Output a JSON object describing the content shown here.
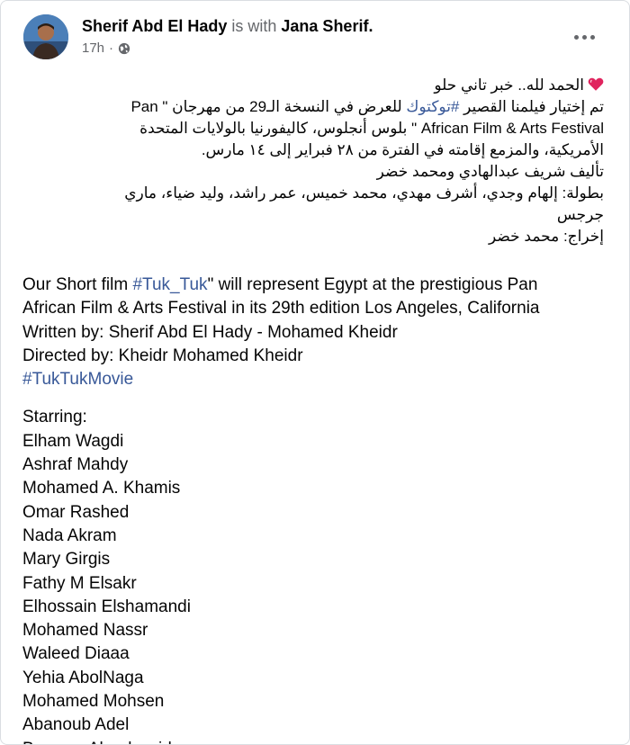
{
  "post": {
    "author": "Sherif Abd El Hady",
    "with_text": "is with",
    "tagged": "Jana Sherif.",
    "time": "17h",
    "separator": "·",
    "privacy_icon": "globe-icon",
    "more_icon": "more-options-icon"
  },
  "arabic": {
    "line1": "الحمد لله.. خبر تاني حلو",
    "line2_pre": "تم إختيار فيلمنا القصير ",
    "line2_tag": "#توكتوك",
    "line2_post": " للعرض في النسخة الـ29 من مهرجان \" Pan",
    "line3": "African Film & Arts Festival \" بلوس أنجلوس، كاليفورنيا بالولايات المتحدة",
    "line4": "الأمريكية، والمزمع إقامته في الفترة من ٢٨ فبراير إلى ١٤ مارس.",
    "line5": "تأليف شريف عبدالهادي ومحمد خضر",
    "line6": "بطولة: إلهام وجدي، أشرف مهدي، محمد خميس، عمر راشد، وليد ضياء، ماري",
    "line7": "جرجس",
    "line8": "إخراج: محمد خضر"
  },
  "english": {
    "line1_pre": "Our Short film ",
    "line1_tag": "#Tuk_Tuk",
    "line1_post": "\" will represent Egypt at the prestigious  Pan",
    "line2": "African Film & Arts Festival in its 29th edition Los Angeles, California",
    "line3": "Written by: Sherif Abd El Hady - Mohamed Kheidr",
    "line4": "Directed by: Kheidr Mohamed Kheidr",
    "hashtag2": "#TukTukMovie",
    "starring_label": "Starring:",
    "cast": [
      "Elham Wagdi",
      "Ashraf Mahdy",
      "Mohamed A. Khamis",
      "Omar Rashed",
      "Nada Akram",
      "Mary Girgis",
      "Fathy M Elsakr",
      "Elhossain Elshamandi",
      "Mohamed Nassr",
      "Waleed Diaaa",
      "Yehia AbolNaga",
      "Mohamed Mohsen",
      "Abanoub Adel",
      "Bassem Aboelyazid"
    ]
  },
  "colors": {
    "link": "#385898",
    "muted": "#65676b",
    "heart": "#e0245e"
  }
}
